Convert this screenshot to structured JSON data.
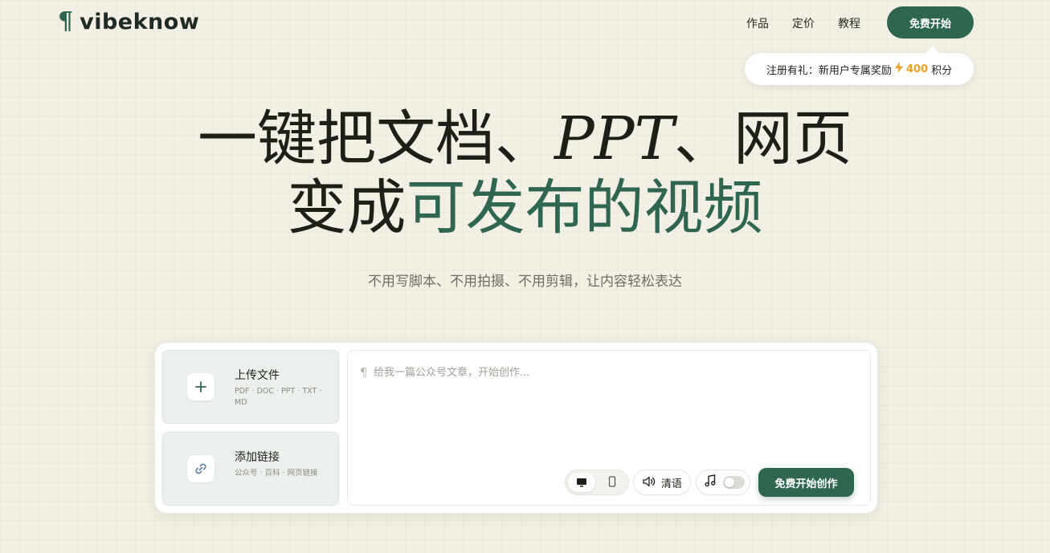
{
  "brand": {
    "mark": "¶",
    "name": "vibeknow"
  },
  "nav": {
    "items": [
      "作品",
      "定价",
      "教程"
    ],
    "cta_label": "免费开始"
  },
  "promo": {
    "text": "注册有礼：新用户专属奖励",
    "points": "400",
    "unit": "积分"
  },
  "hero": {
    "line1_a": "一键把文档、",
    "line1_ppt": "PPT",
    "line1_b": "、网页",
    "line2_dark": "变成",
    "line2_green": "可发布的视频",
    "subtitle": "不用写脚本、不用拍摄、不用剪辑，让内容轻松表达"
  },
  "upload": {
    "title": "上传文件",
    "formats": "PDF · DOC · PPT · TXT · MD"
  },
  "link": {
    "title": "添加链接",
    "sources": "公众号 · 百科 · 网页链接"
  },
  "prompt": {
    "marker": "¶",
    "placeholder": "给我一篇公众号文章，开始创作..."
  },
  "controls": {
    "voice_label": "清语",
    "create_label": "免费开始创作"
  },
  "colors": {
    "accent": "#2e6650",
    "background": "#f2efe4",
    "points": "#f0a020"
  },
  "icons": {
    "upload": "plus-icon",
    "link": "link-icon",
    "landscape": "monitor-icon",
    "portrait": "phone-icon",
    "voice": "speaker-icon",
    "music": "music-note-icon",
    "promo": "bolt-icon"
  }
}
